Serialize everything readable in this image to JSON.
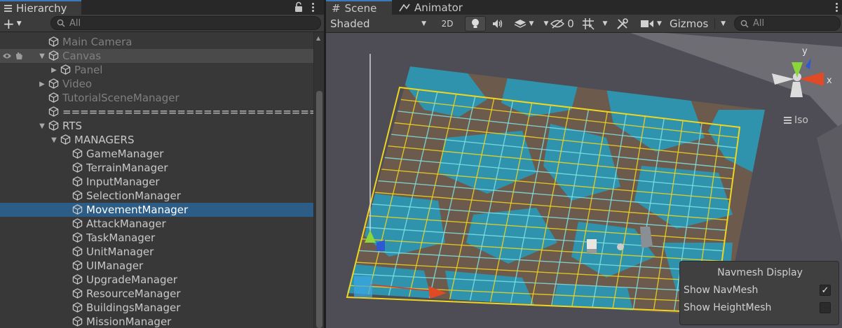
{
  "hierarchy": {
    "tab_label": "Hierarchy",
    "add_label": "+",
    "search_placeholder": "All",
    "rows": [
      {
        "label": "Main Camera",
        "depth": 1,
        "fold": "",
        "state": "dim"
      },
      {
        "label": "Canvas",
        "depth": 1,
        "fold": "▼",
        "state": "dim-active",
        "vis": true
      },
      {
        "label": "Panel",
        "depth": 2,
        "fold": "▶",
        "state": "dim"
      },
      {
        "label": "Video",
        "depth": 1,
        "fold": "▶",
        "state": "dim"
      },
      {
        "label": "TutorialSceneManager",
        "depth": 1,
        "fold": "",
        "state": "dim"
      },
      {
        "label": "=====================================",
        "depth": 1,
        "fold": "",
        "state": "normal"
      },
      {
        "label": "RTS",
        "depth": 1,
        "fold": "▼",
        "state": "normal"
      },
      {
        "label": "MANAGERS",
        "depth": 2,
        "fold": "▼",
        "state": "normal"
      },
      {
        "label": "GameManager",
        "depth": 3,
        "fold": "",
        "state": "normal"
      },
      {
        "label": "TerrainManager",
        "depth": 3,
        "fold": "",
        "state": "normal"
      },
      {
        "label": "InputManager",
        "depth": 3,
        "fold": "",
        "state": "normal"
      },
      {
        "label": "SelectionManager",
        "depth": 3,
        "fold": "",
        "state": "normal"
      },
      {
        "label": "MovementManager",
        "depth": 3,
        "fold": "",
        "state": "selected"
      },
      {
        "label": "AttackManager",
        "depth": 3,
        "fold": "",
        "state": "normal"
      },
      {
        "label": "TaskManager",
        "depth": 3,
        "fold": "",
        "state": "normal"
      },
      {
        "label": "UnitManager",
        "depth": 3,
        "fold": "",
        "state": "normal"
      },
      {
        "label": "UIManager",
        "depth": 3,
        "fold": "",
        "state": "normal"
      },
      {
        "label": "UpgradeManager",
        "depth": 3,
        "fold": "",
        "state": "normal"
      },
      {
        "label": "ResourceManager",
        "depth": 3,
        "fold": "",
        "state": "normal"
      },
      {
        "label": "BuildingsManager",
        "depth": 3,
        "fold": "",
        "state": "normal"
      },
      {
        "label": "MissionManager",
        "depth": 3,
        "fold": "",
        "state": "normal"
      }
    ]
  },
  "scene": {
    "tabs": [
      {
        "label": "Scene",
        "icon": "grid-icon"
      },
      {
        "label": "Animator",
        "icon": "animator-icon"
      }
    ],
    "toolbar": {
      "shading_mode": "Shaded",
      "mode_2d": "2D",
      "hidden_count": "0",
      "gizmos_label": "Gizmos",
      "search_placeholder": "All"
    },
    "orientation": {
      "x_label": "x",
      "y_label": "y",
      "projection": "Iso"
    },
    "navmesh_display": {
      "title": "Navmesh Display",
      "options": [
        {
          "label": "Show NavMesh",
          "checked": true
        },
        {
          "label": "Show HeightMesh",
          "checked": false
        }
      ]
    }
  }
}
